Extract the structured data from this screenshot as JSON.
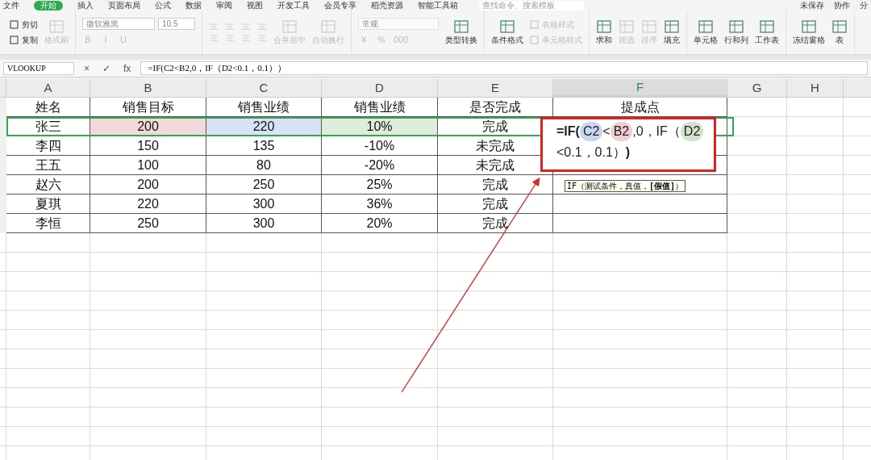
{
  "menu": {
    "items": [
      {
        "label": "文件",
        "selected": false
      },
      {
        "label": "开始",
        "selected": true
      },
      {
        "label": "插入",
        "selected": false
      },
      {
        "label": "页面布局",
        "selected": false
      },
      {
        "label": "公式",
        "selected": false
      },
      {
        "label": "数据",
        "selected": false
      },
      {
        "label": "审阅",
        "selected": false
      },
      {
        "label": "视图",
        "selected": false
      },
      {
        "label": "开发工具",
        "selected": false
      },
      {
        "label": "会员专享",
        "selected": false
      },
      {
        "label": "稻壳资源",
        "selected": false
      },
      {
        "label": "智能工具箱",
        "selected": false
      }
    ],
    "search": {
      "placeholder": "查找命令、搜索模板"
    },
    "actions": [
      "未保存",
      "协作",
      "分"
    ]
  },
  "ribbon": [
    {
      "columns": [
        [
          {
            "kind": "small",
            "label": "剪切",
            "disabled": false
          },
          {
            "kind": "small",
            "label": "复制",
            "disabled": false
          }
        ],
        [
          {
            "kind": "large",
            "label": "格式刷",
            "disabled": true
          }
        ]
      ]
    },
    {
      "columns": [
        [
          {
            "kind": "fieldpair",
            "value": "微软雅黑",
            "value2": "10.5"
          },
          {
            "kind": "glyphs",
            "glyphs": [
              "B",
              "I",
              "U"
            ],
            "disabled": true
          }
        ]
      ]
    },
    {
      "columns": [
        [
          {
            "kind": "align",
            "disabled": true
          },
          {
            "kind": "align",
            "disabled": true
          }
        ],
        [
          {
            "kind": "large",
            "label": "合并居中",
            "disabled": true
          }
        ],
        [
          {
            "kind": "large",
            "label": "自动换行",
            "disabled": true
          }
        ]
      ]
    },
    {
      "columns": [
        [
          {
            "kind": "field",
            "value": "常规"
          },
          {
            "kind": "glyphs",
            "glyphs": [
              "¥",
              "%",
              "000"
            ],
            "disabled": true
          }
        ],
        [
          {
            "kind": "large",
            "label": "类型转换",
            "disabled": false
          }
        ]
      ]
    },
    {
      "columns": [
        [
          {
            "kind": "large",
            "label": "条件格式",
            "disabled": false
          }
        ],
        [
          {
            "kind": "small",
            "label": "表格样式",
            "disabled": true
          },
          {
            "kind": "small",
            "label": "单元格样式",
            "disabled": true
          }
        ]
      ]
    },
    {
      "columns": [
        [
          {
            "kind": "large",
            "label": "求和",
            "disabled": false
          }
        ],
        [
          {
            "kind": "large",
            "label": "筛选",
            "disabled": true
          }
        ],
        [
          {
            "kind": "large",
            "label": "排序",
            "disabled": true
          }
        ],
        [
          {
            "kind": "large",
            "label": "填充",
            "disabled": false
          }
        ]
      ]
    },
    {
      "columns": [
        [
          {
            "kind": "large",
            "label": "单元格",
            "disabled": false
          }
        ],
        [
          {
            "kind": "large",
            "label": "行和列",
            "disabled": false
          }
        ],
        [
          {
            "kind": "large",
            "label": "工作表",
            "disabled": false
          }
        ]
      ]
    },
    {
      "columns": [
        [
          {
            "kind": "large",
            "label": "冻结窗格",
            "disabled": false
          }
        ],
        [
          {
            "kind": "large",
            "label": "表",
            "disabled": false
          }
        ]
      ]
    }
  ],
  "formula_bar": {
    "name_box": "VLOOKUP",
    "buttons": [
      "×",
      "✓",
      "fx"
    ],
    "formula": "=IF(C2<B2,0，IF（D2<0.1，0.1））"
  },
  "sheet": {
    "columns": [
      {
        "label": "A",
        "selected": false
      },
      {
        "label": "B",
        "selected": false
      },
      {
        "label": "C",
        "selected": false
      },
      {
        "label": "D",
        "selected": false
      },
      {
        "label": "E",
        "selected": false
      },
      {
        "label": "F",
        "selected": true
      },
      {
        "label": "G",
        "selected": false
      },
      {
        "label": "H",
        "selected": false
      }
    ],
    "rows": [
      {
        "cells": [
          {
            "text": "姓名"
          },
          {
            "text": "销售目标"
          },
          {
            "text": "销售业绩"
          },
          {
            "text": "销售业绩"
          },
          {
            "text": "是否完成"
          },
          {
            "text": "提成点"
          }
        ]
      },
      {
        "cells": [
          {
            "text": "张三"
          },
          {
            "text": "200",
            "color": "#f3d9da"
          },
          {
            "text": "220",
            "color": "#d9e1f4"
          },
          {
            "text": "10%",
            "color": "#dfecd9"
          },
          {
            "text": "完成"
          },
          {
            "text": ""
          }
        ]
      },
      {
        "cells": [
          {
            "text": "李四"
          },
          {
            "text": "150"
          },
          {
            "text": "135"
          },
          {
            "text": "-10%"
          },
          {
            "text": "未完成"
          },
          {
            "text": ""
          }
        ]
      },
      {
        "cells": [
          {
            "text": "王五"
          },
          {
            "text": "100"
          },
          {
            "text": "80"
          },
          {
            "text": "-20%"
          },
          {
            "text": "未完成"
          },
          {
            "text": ""
          }
        ]
      },
      {
        "cells": [
          {
            "text": "赵六"
          },
          {
            "text": "200"
          },
          {
            "text": "250"
          },
          {
            "text": "25%"
          },
          {
            "text": "完成"
          },
          {
            "text": ""
          }
        ]
      },
      {
        "cells": [
          {
            "text": "夏琪"
          },
          {
            "text": "220"
          },
          {
            "text": "300"
          },
          {
            "text": "36%"
          },
          {
            "text": "完成"
          },
          {
            "text": ""
          }
        ]
      },
      {
        "cells": [
          {
            "text": "李恒"
          },
          {
            "text": "250"
          },
          {
            "text": "300"
          },
          {
            "text": "20%"
          },
          {
            "text": "完成"
          },
          {
            "text": ""
          }
        ]
      }
    ]
  },
  "cell_editor": {
    "lines": [
      [
        {
          "kind": "bold",
          "text": "=IF("
        },
        {
          "kind": "ref",
          "text": "C2",
          "color": "#c9d6f0"
        },
        {
          "kind": "plain",
          "text": "<"
        },
        {
          "kind": "ref",
          "text": "B2",
          "color": "#efcfd1"
        },
        {
          "kind": "plain",
          "text": ",0，IF（"
        },
        {
          "kind": "ref",
          "text": "D2",
          "color": "#d3e2cb"
        }
      ],
      [
        {
          "kind": "plain",
          "text": "<0.1，0.1）"
        },
        {
          "kind": "bold",
          "text": ")"
        }
      ]
    ]
  },
  "tooltip": "IF（测试条件，真值，**[假值]**）"
}
